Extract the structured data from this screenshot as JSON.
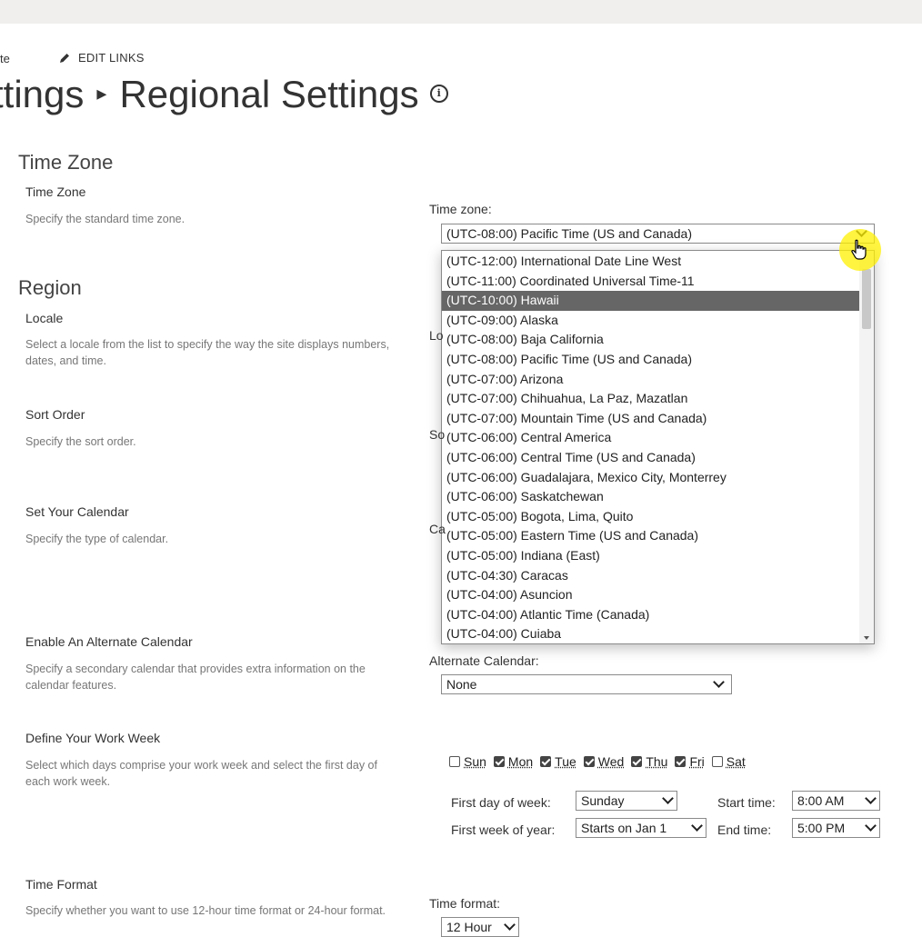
{
  "nav": {
    "crumb_tail": "te",
    "edit_links": "EDIT LINKS"
  },
  "page": {
    "title_left": "ttings",
    "title_sep": "▸",
    "title_right": "Regional Settings",
    "info_glyph": "i"
  },
  "timezone": {
    "section": "Time Zone",
    "label": "Time Zone",
    "desc": "Specify the standard time zone.",
    "field_label": "Time zone:",
    "value": "(UTC-08:00) Pacific Time (US and Canada)",
    "options": [
      "(UTC-12:00) International Date Line West",
      "(UTC-11:00) Coordinated Universal Time-11",
      "(UTC-10:00) Hawaii",
      "(UTC-09:00) Alaska",
      "(UTC-08:00) Baja California",
      "(UTC-08:00) Pacific Time (US and Canada)",
      "(UTC-07:00) Arizona",
      "(UTC-07:00) Chihuahua, La Paz, Mazatlan",
      "(UTC-07:00) Mountain Time (US and Canada)",
      "(UTC-06:00) Central America",
      "(UTC-06:00) Central Time (US and Canada)",
      "(UTC-06:00) Guadalajara, Mexico City, Monterrey",
      "(UTC-06:00) Saskatchewan",
      "(UTC-05:00) Bogota, Lima, Quito",
      "(UTC-05:00) Eastern Time (US and Canada)",
      "(UTC-05:00) Indiana (East)",
      "(UTC-04:30) Caracas",
      "(UTC-04:00) Asuncion",
      "(UTC-04:00) Atlantic Time (Canada)",
      "(UTC-04:00) Cuiaba"
    ],
    "highlighted": "(UTC-10:00) Hawaii"
  },
  "region": {
    "section": "Region",
    "locale_label": "Locale",
    "locale_desc": "Select a locale from the list to specify the way the site displays numbers, dates, and time.",
    "locale_field_stub": "Lo",
    "sort_label": "Sort Order",
    "sort_desc": "Specify the sort order.",
    "sort_field_stub": "So",
    "calendar_label": "Set Your Calendar",
    "calendar_desc": "Specify the type of calendar.",
    "calendar_field_stub": "Ca",
    "alt_label": "Enable An Alternate Calendar",
    "alt_desc": "Specify a secondary calendar that provides extra information on the calendar features.",
    "alt_field_label": "Alternate Calendar:",
    "alt_value": "None",
    "week_label": "Define Your Work Week",
    "week_desc": "Select which days comprise your work week and select the first day of each work week.",
    "days": [
      {
        "label": "Sun",
        "checked": false
      },
      {
        "label": "Mon",
        "checked": true
      },
      {
        "label": "Tue",
        "checked": true
      },
      {
        "label": "Wed",
        "checked": true
      },
      {
        "label": "Thu",
        "checked": true
      },
      {
        "label": "Fri",
        "checked": true
      },
      {
        "label": "Sat",
        "checked": false
      }
    ],
    "first_day_label": "First day of week:",
    "first_day_value": "Sunday",
    "first_week_label": "First week of year:",
    "first_week_value": "Starts on Jan 1",
    "start_time_label": "Start time:",
    "start_time_value": "8:00 AM",
    "end_time_label": "End time:",
    "end_time_value": "5:00 PM",
    "timefmt_label": "Time Format",
    "timefmt_desc": "Specify whether you want to use 12-hour time format or 24-hour format.",
    "timefmt_field_label": "Time format:",
    "timefmt_value": "12 Hour"
  }
}
